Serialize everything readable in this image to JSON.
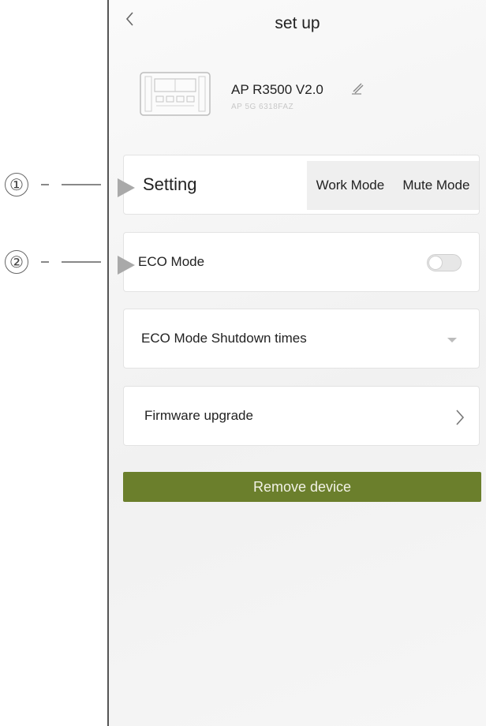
{
  "callouts": [
    {
      "number": "①"
    },
    {
      "number": "②"
    }
  ],
  "header": {
    "title": "set up",
    "back_icon": "chevron-left-icon"
  },
  "device": {
    "name": "AP R3500 V2.0",
    "serial": "AP 5G 6318FAZ",
    "edit_icon": "pencil-icon"
  },
  "setting_row": {
    "label": "Setting",
    "options": [
      "Work Mode",
      "Mute Mode"
    ]
  },
  "eco_row": {
    "label": "ECO Mode",
    "toggle_on": false
  },
  "eco_shutdown_row": {
    "label": "ECO Mode Shutdown times",
    "icon": "dropdown-arrow-icon"
  },
  "firmware_row": {
    "label": "Firmware upgrade",
    "icon": "chevron-right-icon"
  },
  "remove_button": {
    "label": "Remove device",
    "color": "#6b7f2c"
  }
}
